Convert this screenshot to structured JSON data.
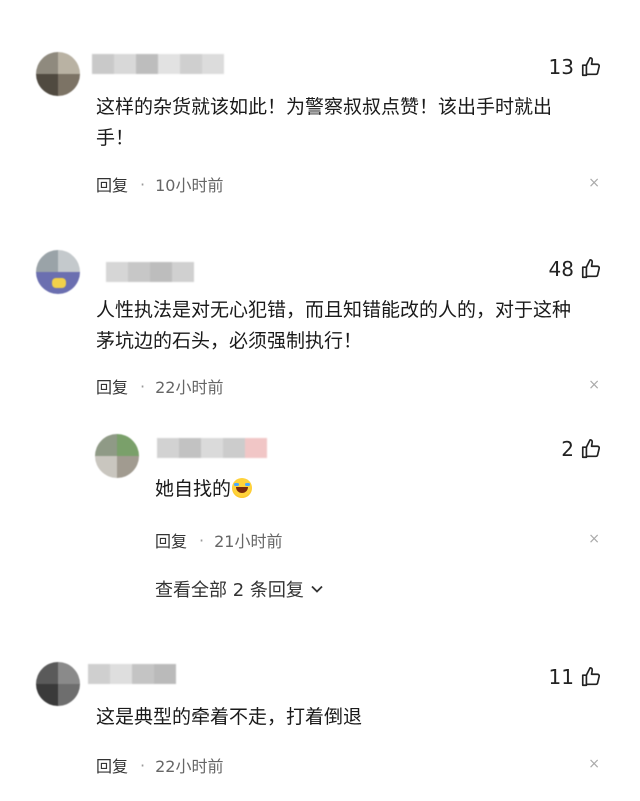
{
  "comments": [
    {
      "likes": "13",
      "text_line1": "这样的杂货就该如此！为警察叔叔点赞！该出手时就出",
      "text_line2": "手！",
      "reply_label": "回复",
      "dot": "·",
      "time": "10小时前",
      "close": "×"
    },
    {
      "likes": "48",
      "text_line1": "人性执法是对无心犯错，而且知错能改的人的，对于这种",
      "text_line2": "茅坑边的石头，必须强制执行！",
      "reply_label": "回复",
      "dot": "·",
      "time": "22小时前",
      "close": "×",
      "sub_reply": {
        "likes": "2",
        "text": "她自找的",
        "emoji": "laughing-crying-emoji",
        "reply_label": "回复",
        "dot": "·",
        "time": "21小时前",
        "close": "×"
      },
      "view_all": "查看全部 2 条回复"
    },
    {
      "likes": "11",
      "text_line1": "这是典型的牵着不走，打着倒退",
      "reply_label": "回复",
      "dot": "·",
      "time": "22小时前",
      "close": "×"
    }
  ],
  "icons": {
    "like": "thumbs-up-icon",
    "chevron": "chevron-down-icon",
    "close": "close-icon"
  },
  "colors": {
    "text": "#1a1a1a",
    "meta": "#666666",
    "close": "#aaaaaa"
  }
}
